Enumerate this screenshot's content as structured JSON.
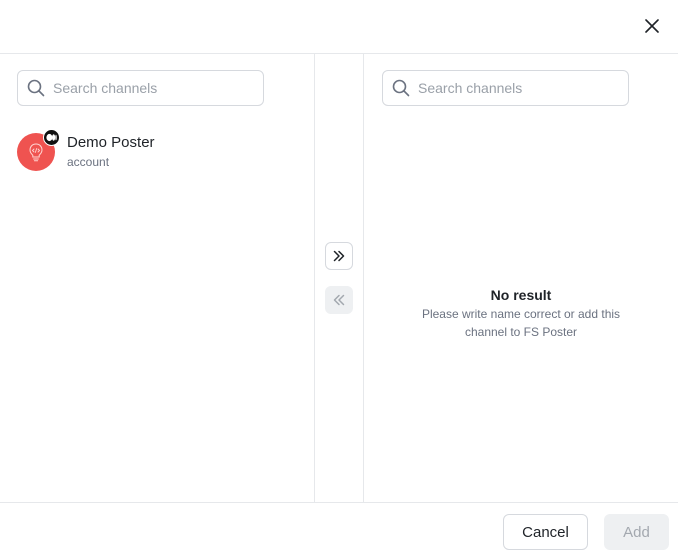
{
  "header": {
    "close_icon": "close-icon"
  },
  "left_panel": {
    "search": {
      "placeholder": "Search channels",
      "value": ""
    },
    "channels": [
      {
        "name": "Demo Poster",
        "type": "account",
        "avatar_color": "#ef5350",
        "avatar_icon": "lightbulb-code-icon",
        "platform_badge_icon": "platform-logo-icon"
      }
    ]
  },
  "transfer": {
    "move_right_icon": "double-chevron-right-icon",
    "move_left_icon": "double-chevron-left-icon"
  },
  "right_panel": {
    "search": {
      "placeholder": "Search channels",
      "value": ""
    },
    "empty_state": {
      "title": "No result",
      "description": "Please write name correct or add this channel to FS Poster"
    }
  },
  "footer": {
    "cancel_label": "Cancel",
    "add_label": "Add"
  },
  "colors": {
    "border": "#e6e8eb",
    "avatar": "#ef5350",
    "disabled_bg": "#eef0f2",
    "disabled_text": "#a3a8af"
  }
}
